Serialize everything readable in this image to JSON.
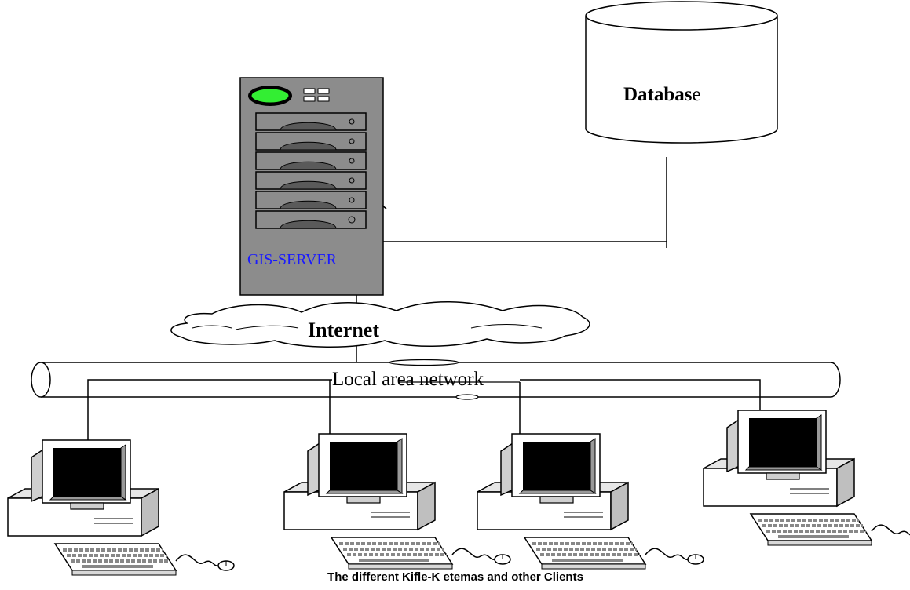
{
  "server": {
    "label": "GIS-SERVER",
    "label_color": "#1a1aff",
    "body_color": "#8c8c8c",
    "led_color": "#33ee33"
  },
  "database": {
    "label_bold": "Databas",
    "label_tail": "e"
  },
  "internet": {
    "label": "Internet"
  },
  "lan": {
    "label": "Local area network"
  },
  "clients": {
    "caption": "The different Kifle-K etemas and other Clients",
    "count": 4
  }
}
